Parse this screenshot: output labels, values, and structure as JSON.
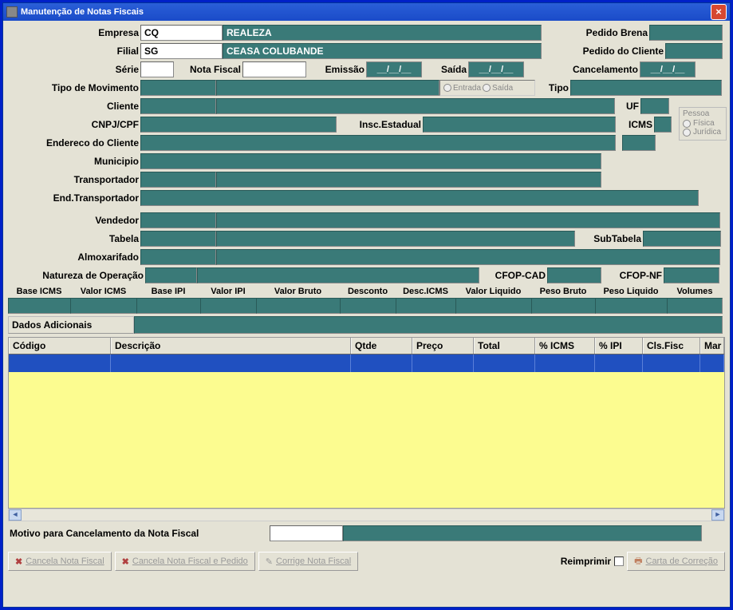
{
  "window": {
    "title": "Manutenção de Notas Fiscais"
  },
  "form": {
    "empresa_lbl": "Empresa",
    "empresa_code": "CQ",
    "empresa_name": "REALEZA",
    "pedido_brena_lbl": "Pedido Brena",
    "pedido_brena": "",
    "filial_lbl": "Filial",
    "filial_code": "SG",
    "filial_name": "CEASA COLUBANDE",
    "pedido_cliente_lbl": "Pedido do Cliente",
    "pedido_cliente": "",
    "serie_lbl": "Série",
    "serie": "",
    "notafiscal_lbl": "Nota Fiscal",
    "notafiscal": "",
    "emissao_lbl": "Emissão",
    "emissao": "__/__/__",
    "saida_lbl": "Saída",
    "saida": "__/__/__",
    "cancelamento_lbl": "Cancelamento",
    "cancelamento": "__/__/__",
    "tipo_mov_lbl": "Tipo de Movimento",
    "tipo_mov": "",
    "entrada_lbl": "Entrada",
    "saida_rb_lbl": "Saída",
    "tipo_lbl": "Tipo",
    "tipo": "",
    "cliente_lbl": "Cliente",
    "cliente_code": "",
    "cliente_name": "",
    "uf_lbl": "UF",
    "uf": "",
    "pessoa_lbl": "Pessoa",
    "pessoa_fisica": "Física",
    "pessoa_juridica": "Jurídica",
    "cnpj_lbl": "CNPJ/CPF",
    "cnpj": "",
    "insc_lbl": "Insc.Estadual",
    "insc": "",
    "icms_lbl": "ICMS",
    "icms": "",
    "endereco_lbl": "Endereco do Cliente",
    "endereco": "",
    "endereco_num": "",
    "municipio_lbl": "Municipio",
    "municipio": "",
    "transp_lbl": "Transportador",
    "transp_code": "",
    "transp_name": "",
    "end_transp_lbl": "End.Transportador",
    "end_transp": "",
    "vendedor_lbl": "Vendedor",
    "vendedor_code": "",
    "vendedor_name": "",
    "tabela_lbl": "Tabela",
    "tabela_code": "",
    "tabela_name": "",
    "subtabela_lbl": "SubTabela",
    "subtabela": "",
    "almox_lbl": "Almoxarifado",
    "almox_code": "",
    "almox_name": "",
    "natureza_lbl": "Natureza de Operação",
    "natureza_code": "",
    "natureza_name": "",
    "cfop_cad_lbl": "CFOP-CAD",
    "cfop_cad": "",
    "cfop_nf_lbl": "CFOP-NF",
    "cfop_nf": ""
  },
  "totals": {
    "headers": [
      "Base ICMS",
      "Valor ICMS",
      "Base IPI",
      "Valor IPI",
      "Valor Bruto",
      "Desconto",
      "Desc.ICMS",
      "Valor Liquido",
      "Peso Bruto",
      "Peso Liquido",
      "Volumes"
    ],
    "values": [
      "",
      "",
      "",
      "",
      "",
      "",
      "",
      "",
      "",
      "",
      ""
    ]
  },
  "dados_adicionais_lbl": "Dados Adicionais",
  "dados_adicionais": "",
  "grid": {
    "columns": [
      "Código",
      "Descrição",
      "Qtde",
      "Preço",
      "Total",
      "% ICMS",
      "% IPI",
      "Cls.Fisc",
      "Mar"
    ]
  },
  "motivo_lbl": "Motivo para Cancelamento da Nota Fiscal",
  "motivo": "",
  "buttons": {
    "cancela_nf": "Cancela Nota Fiscal",
    "cancela_nf_pedido": "Cancela Nota Fiscal e Pedido",
    "corrige_nf": "Corrige Nota Fiscal",
    "reimprimir_lbl": "Reimprimir",
    "carta_correcao": "Carta de Correção"
  }
}
